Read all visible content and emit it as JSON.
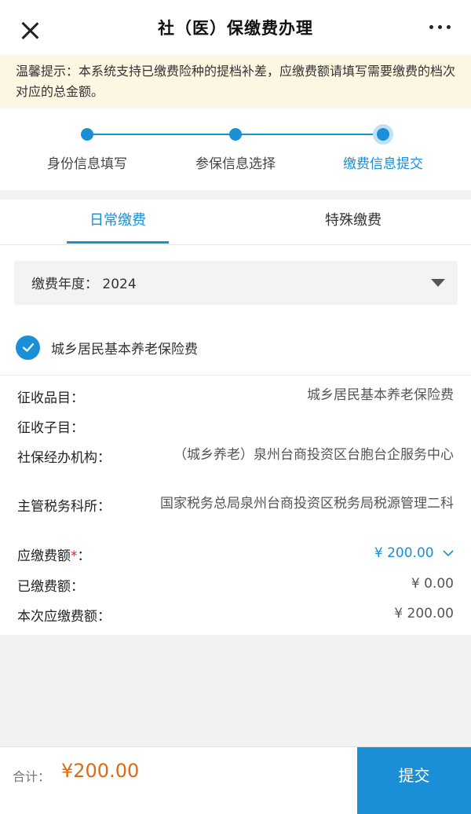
{
  "header": {
    "title": "社（医）保缴费办理"
  },
  "notice": {
    "text": "温馨提示：本系统支持已缴费险种的提档补差，应缴费额请填写需要缴费的档次对应的总金额。"
  },
  "steps": [
    {
      "label": "身份信息填写"
    },
    {
      "label": "参保信息选择"
    },
    {
      "label": "缴费信息提交"
    }
  ],
  "tabs": [
    {
      "label": "日常缴费",
      "active": true
    },
    {
      "label": "特殊缴费",
      "active": false
    }
  ],
  "year_select": {
    "label": "缴费年度：",
    "value": "2024"
  },
  "insurance": {
    "label": "城乡居民基本养老保险费",
    "checked": true
  },
  "details": {
    "item_label": "征收品目：",
    "item_value": "城乡居民基本养老保险费",
    "subitem_label": "征收子目：",
    "subitem_value": "",
    "agency_label": "社保经办机构：",
    "agency_value": "（城乡养老）泉州台商投资区台胞台企服务中心",
    "tax_label": "主管税务科所：",
    "tax_value": "国家税务总局泉州台商投资区税务局税源管理二科",
    "due_label": "应缴费额",
    "due_required": "*",
    "due_colon": "：",
    "due_value": "¥ 200.00",
    "paid_label": "已缴费额：",
    "paid_value": "¥ 0.00",
    "current_label": "本次应缴费额：",
    "current_value": "¥ 200.00"
  },
  "footer": {
    "total_label": "合计：",
    "total_value": "¥200.00",
    "submit_label": "提交"
  },
  "colors": {
    "accent": "#1a8fd8",
    "amount": "#e06a12",
    "notice_bg": "#fdf6e3",
    "required": "#d6262d"
  },
  "icons": [
    "close-icon",
    "more-icon",
    "dropdown-caret-icon",
    "check-icon",
    "chevron-down-icon"
  ]
}
